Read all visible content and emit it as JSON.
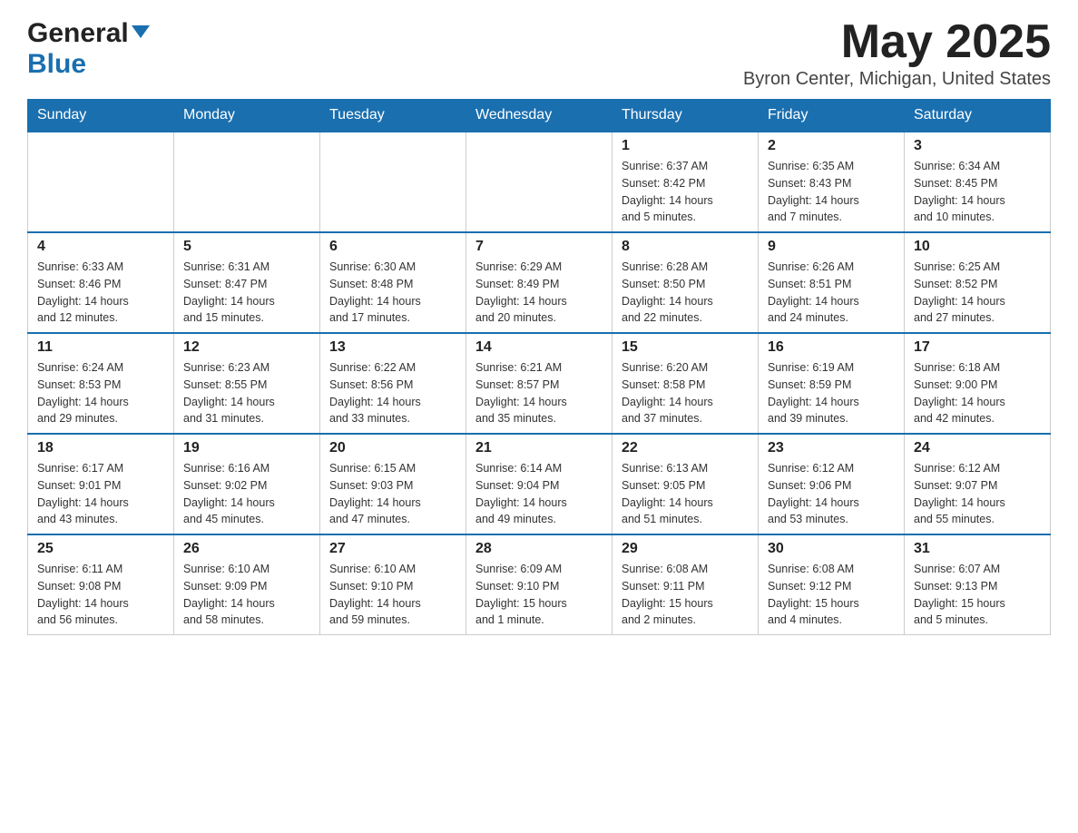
{
  "header": {
    "logo_general": "General",
    "logo_blue": "Blue",
    "month_year": "May 2025",
    "location": "Byron Center, Michigan, United States"
  },
  "days_of_week": [
    "Sunday",
    "Monday",
    "Tuesday",
    "Wednesday",
    "Thursday",
    "Friday",
    "Saturday"
  ],
  "weeks": [
    [
      {
        "day": "",
        "info": ""
      },
      {
        "day": "",
        "info": ""
      },
      {
        "day": "",
        "info": ""
      },
      {
        "day": "",
        "info": ""
      },
      {
        "day": "1",
        "info": "Sunrise: 6:37 AM\nSunset: 8:42 PM\nDaylight: 14 hours\nand 5 minutes."
      },
      {
        "day": "2",
        "info": "Sunrise: 6:35 AM\nSunset: 8:43 PM\nDaylight: 14 hours\nand 7 minutes."
      },
      {
        "day": "3",
        "info": "Sunrise: 6:34 AM\nSunset: 8:45 PM\nDaylight: 14 hours\nand 10 minutes."
      }
    ],
    [
      {
        "day": "4",
        "info": "Sunrise: 6:33 AM\nSunset: 8:46 PM\nDaylight: 14 hours\nand 12 minutes."
      },
      {
        "day": "5",
        "info": "Sunrise: 6:31 AM\nSunset: 8:47 PM\nDaylight: 14 hours\nand 15 minutes."
      },
      {
        "day": "6",
        "info": "Sunrise: 6:30 AM\nSunset: 8:48 PM\nDaylight: 14 hours\nand 17 minutes."
      },
      {
        "day": "7",
        "info": "Sunrise: 6:29 AM\nSunset: 8:49 PM\nDaylight: 14 hours\nand 20 minutes."
      },
      {
        "day": "8",
        "info": "Sunrise: 6:28 AM\nSunset: 8:50 PM\nDaylight: 14 hours\nand 22 minutes."
      },
      {
        "day": "9",
        "info": "Sunrise: 6:26 AM\nSunset: 8:51 PM\nDaylight: 14 hours\nand 24 minutes."
      },
      {
        "day": "10",
        "info": "Sunrise: 6:25 AM\nSunset: 8:52 PM\nDaylight: 14 hours\nand 27 minutes."
      }
    ],
    [
      {
        "day": "11",
        "info": "Sunrise: 6:24 AM\nSunset: 8:53 PM\nDaylight: 14 hours\nand 29 minutes."
      },
      {
        "day": "12",
        "info": "Sunrise: 6:23 AM\nSunset: 8:55 PM\nDaylight: 14 hours\nand 31 minutes."
      },
      {
        "day": "13",
        "info": "Sunrise: 6:22 AM\nSunset: 8:56 PM\nDaylight: 14 hours\nand 33 minutes."
      },
      {
        "day": "14",
        "info": "Sunrise: 6:21 AM\nSunset: 8:57 PM\nDaylight: 14 hours\nand 35 minutes."
      },
      {
        "day": "15",
        "info": "Sunrise: 6:20 AM\nSunset: 8:58 PM\nDaylight: 14 hours\nand 37 minutes."
      },
      {
        "day": "16",
        "info": "Sunrise: 6:19 AM\nSunset: 8:59 PM\nDaylight: 14 hours\nand 39 minutes."
      },
      {
        "day": "17",
        "info": "Sunrise: 6:18 AM\nSunset: 9:00 PM\nDaylight: 14 hours\nand 42 minutes."
      }
    ],
    [
      {
        "day": "18",
        "info": "Sunrise: 6:17 AM\nSunset: 9:01 PM\nDaylight: 14 hours\nand 43 minutes."
      },
      {
        "day": "19",
        "info": "Sunrise: 6:16 AM\nSunset: 9:02 PM\nDaylight: 14 hours\nand 45 minutes."
      },
      {
        "day": "20",
        "info": "Sunrise: 6:15 AM\nSunset: 9:03 PM\nDaylight: 14 hours\nand 47 minutes."
      },
      {
        "day": "21",
        "info": "Sunrise: 6:14 AM\nSunset: 9:04 PM\nDaylight: 14 hours\nand 49 minutes."
      },
      {
        "day": "22",
        "info": "Sunrise: 6:13 AM\nSunset: 9:05 PM\nDaylight: 14 hours\nand 51 minutes."
      },
      {
        "day": "23",
        "info": "Sunrise: 6:12 AM\nSunset: 9:06 PM\nDaylight: 14 hours\nand 53 minutes."
      },
      {
        "day": "24",
        "info": "Sunrise: 6:12 AM\nSunset: 9:07 PM\nDaylight: 14 hours\nand 55 minutes."
      }
    ],
    [
      {
        "day": "25",
        "info": "Sunrise: 6:11 AM\nSunset: 9:08 PM\nDaylight: 14 hours\nand 56 minutes."
      },
      {
        "day": "26",
        "info": "Sunrise: 6:10 AM\nSunset: 9:09 PM\nDaylight: 14 hours\nand 58 minutes."
      },
      {
        "day": "27",
        "info": "Sunrise: 6:10 AM\nSunset: 9:10 PM\nDaylight: 14 hours\nand 59 minutes."
      },
      {
        "day": "28",
        "info": "Sunrise: 6:09 AM\nSunset: 9:10 PM\nDaylight: 15 hours\nand 1 minute."
      },
      {
        "day": "29",
        "info": "Sunrise: 6:08 AM\nSunset: 9:11 PM\nDaylight: 15 hours\nand 2 minutes."
      },
      {
        "day": "30",
        "info": "Sunrise: 6:08 AM\nSunset: 9:12 PM\nDaylight: 15 hours\nand 4 minutes."
      },
      {
        "day": "31",
        "info": "Sunrise: 6:07 AM\nSunset: 9:13 PM\nDaylight: 15 hours\nand 5 minutes."
      }
    ]
  ]
}
